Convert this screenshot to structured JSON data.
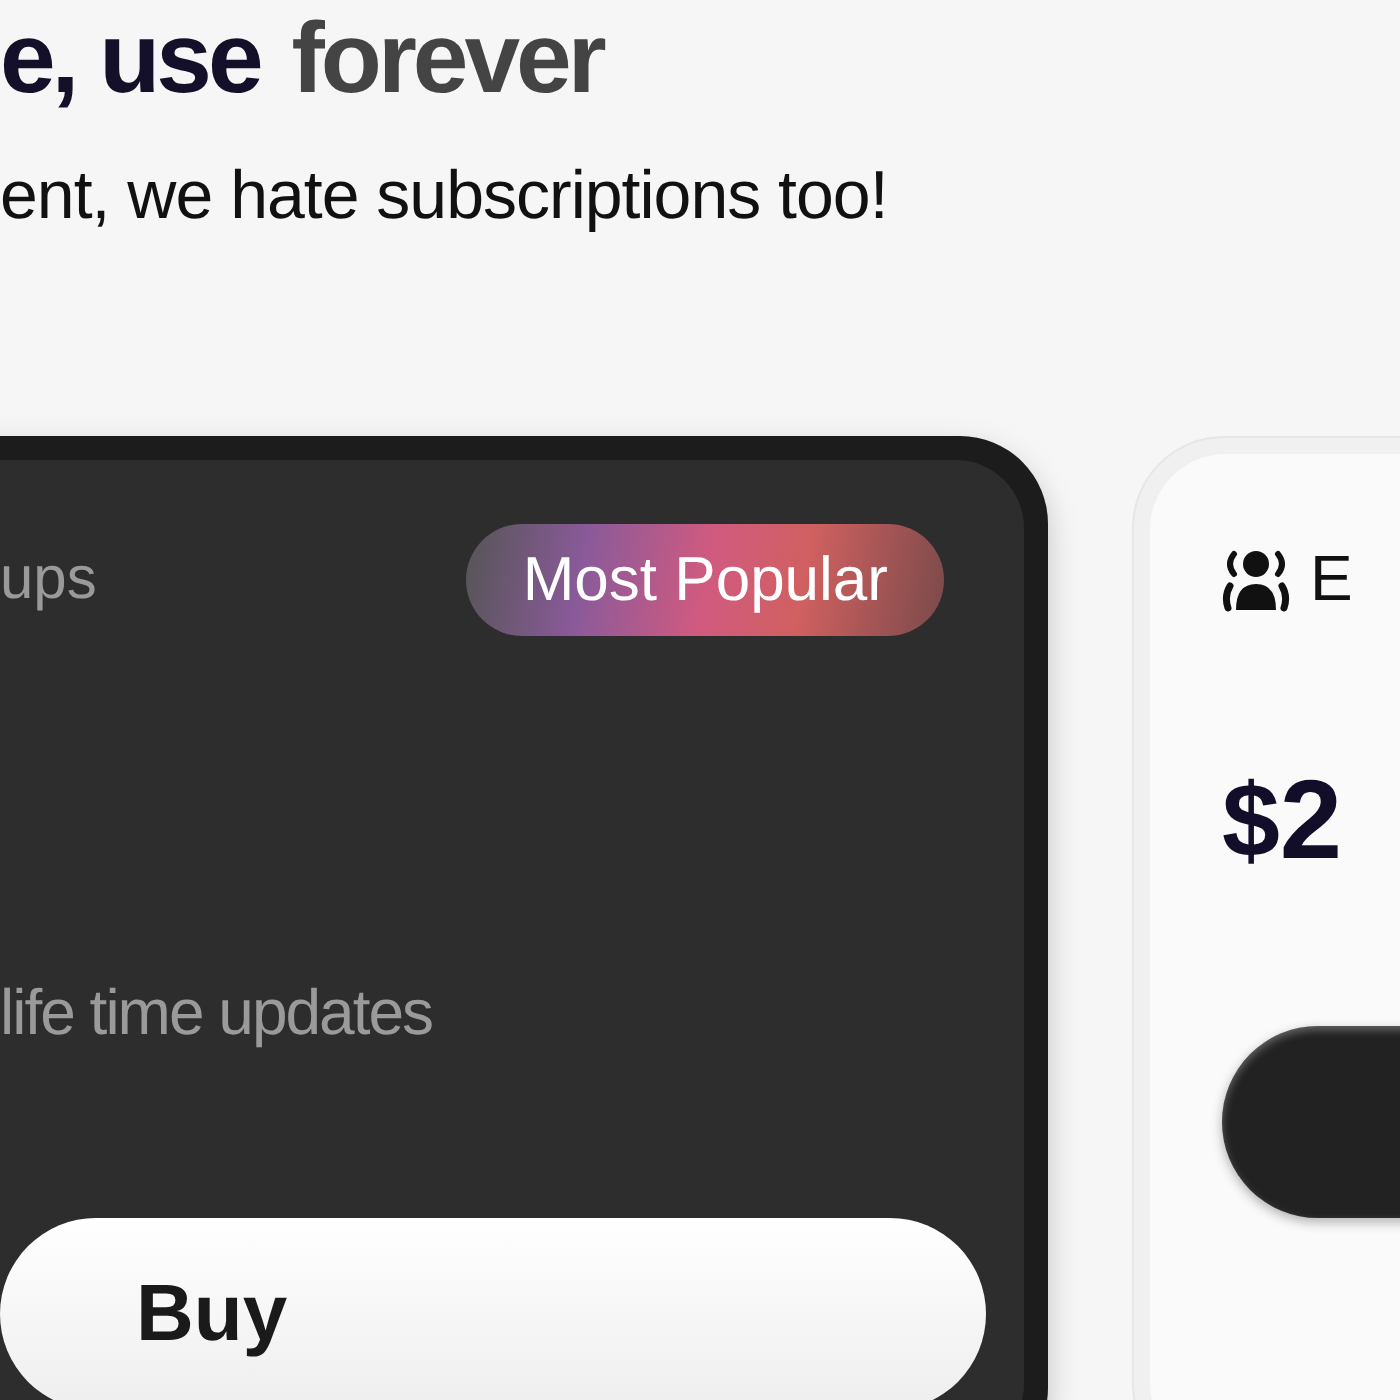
{
  "heading": [
    {
      "text": "e, use",
      "color": "#14102a"
    },
    {
      "text": "forever",
      "color": "#444444"
    }
  ],
  "subtitle": "ent, we hate subscriptions too!",
  "plans": [
    {
      "kind": "dark",
      "title": "ups",
      "badge": "Most Popular",
      "feature": "life time updates",
      "button": "Buy"
    },
    {
      "kind": "light",
      "title": "E",
      "currency": "$",
      "amount": "2"
    }
  ]
}
